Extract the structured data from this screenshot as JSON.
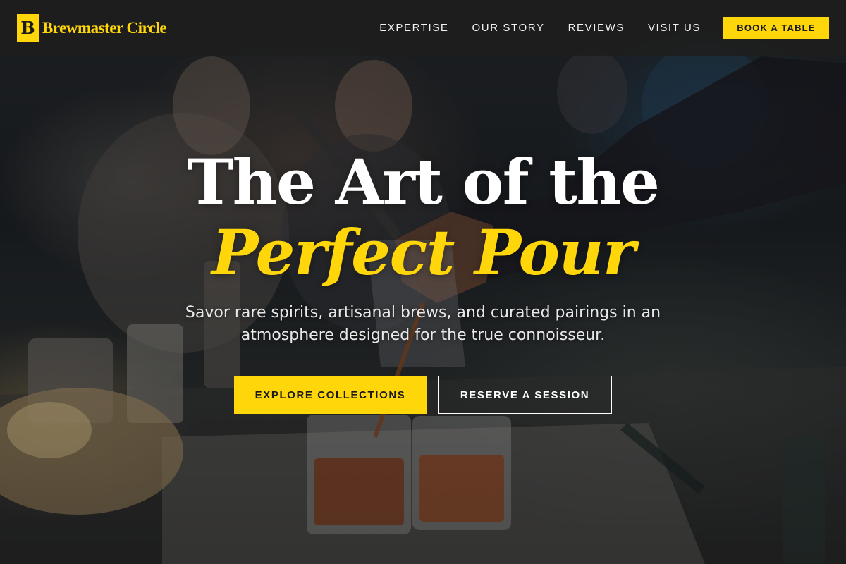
{
  "brand": {
    "mark": "B",
    "name": "Brewmaster Circle",
    "accent_color": "#ffd60a"
  },
  "nav": {
    "items": [
      {
        "label": "EXPERTISE"
      },
      {
        "label": "OUR STORY"
      },
      {
        "label": "REVIEWS"
      },
      {
        "label": "VISIT US"
      }
    ],
    "cta_label": "BOOK A TABLE"
  },
  "hero": {
    "title_line1": "The Art of the",
    "title_line2": "Perfect Pour",
    "subtitle": "Savor rare spirits, artisanal brews, and curated pairings in an atmosphere designed for the true connoisseur.",
    "primary_button": "EXPLORE COLLECTIONS",
    "secondary_button": "RESERVE A SESSION",
    "background": "bartender-pouring-whiskey-photo"
  }
}
